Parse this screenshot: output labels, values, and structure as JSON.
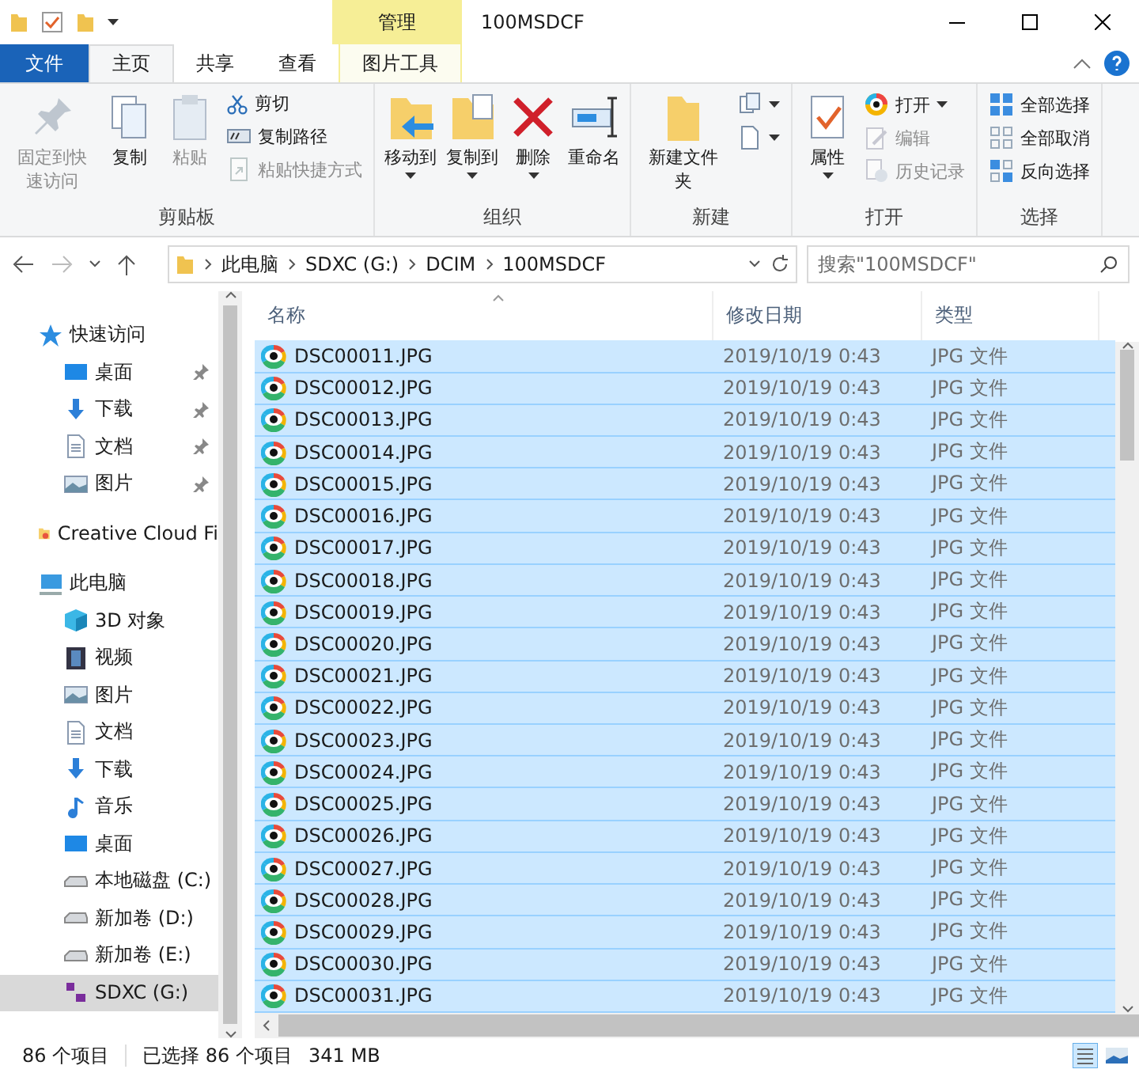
{
  "window": {
    "title": "100MSDCF",
    "context_tab": "管理"
  },
  "ribbon_tabs": [
    {
      "label": "文件",
      "kind": "file",
      "selected": false
    },
    {
      "label": "主页",
      "kind": "normal",
      "selected": true
    },
    {
      "label": "共享",
      "kind": "normal",
      "selected": false
    },
    {
      "label": "查看",
      "kind": "normal",
      "selected": false
    },
    {
      "label": "图片工具",
      "kind": "context",
      "selected": false
    }
  ],
  "ribbon_groups": [
    {
      "label": "剪贴板",
      "buttons": [
        {
          "label": "固定到快速访问",
          "kind": "large",
          "disabled": true
        },
        {
          "label": "复制",
          "kind": "large",
          "disabled": false
        },
        {
          "label": "粘贴",
          "kind": "large",
          "disabled": true
        },
        {
          "label": "剪切",
          "kind": "small",
          "disabled": false
        },
        {
          "label": "复制路径",
          "kind": "small",
          "disabled": false
        },
        {
          "label": "粘贴快捷方式",
          "kind": "small",
          "disabled": true
        }
      ]
    },
    {
      "label": "组织",
      "buttons": [
        {
          "label": "移动到",
          "kind": "large",
          "disabled": false,
          "dropdown": true
        },
        {
          "label": "复制到",
          "kind": "large",
          "disabled": false,
          "dropdown": true
        },
        {
          "label": "删除",
          "kind": "large",
          "disabled": false,
          "dropdown": true
        },
        {
          "label": "重命名",
          "kind": "large",
          "disabled": false
        }
      ]
    },
    {
      "label": "新建",
      "buttons": [
        {
          "label": "新建文件夹",
          "kind": "large",
          "disabled": false
        },
        {
          "kind": "icon",
          "disabled": false,
          "dropdown": true
        },
        {
          "kind": "icon",
          "disabled": false,
          "dropdown": true
        }
      ]
    },
    {
      "label": "打开",
      "buttons": [
        {
          "label": "属性",
          "kind": "large",
          "disabled": false,
          "dropdown": true
        },
        {
          "label": "打开",
          "kind": "small",
          "disabled": false,
          "dropdown": true
        },
        {
          "label": "编辑",
          "kind": "small",
          "disabled": true
        },
        {
          "label": "历史记录",
          "kind": "small",
          "disabled": true
        }
      ]
    },
    {
      "label": "选择",
      "buttons": [
        {
          "label": "全部选择",
          "kind": "small",
          "disabled": false
        },
        {
          "label": "全部取消",
          "kind": "small",
          "disabled": false
        },
        {
          "label": "反向选择",
          "kind": "small",
          "disabled": false
        }
      ]
    }
  ],
  "address": {
    "path": [
      "此电脑",
      "SDXC (G:)",
      "DCIM",
      "100MSDCF"
    ],
    "search_placeholder": "搜索\"100MSDCF\""
  },
  "sidebar": [
    {
      "label": "快速访问",
      "kind": "star",
      "children": [
        {
          "label": "桌面",
          "kind": "desktop",
          "pinned": true
        },
        {
          "label": "下载",
          "kind": "download",
          "pinned": true
        },
        {
          "label": "文档",
          "kind": "document",
          "pinned": true
        },
        {
          "label": "图片",
          "kind": "pictures",
          "pinned": true
        }
      ]
    },
    {
      "label": "Creative Cloud Fi",
      "kind": "cloud"
    },
    {
      "label": "此电脑",
      "kind": "pc",
      "children": [
        {
          "label": "3D 对象",
          "kind": "cube"
        },
        {
          "label": "视频",
          "kind": "video"
        },
        {
          "label": "图片",
          "kind": "pictures"
        },
        {
          "label": "文档",
          "kind": "document"
        },
        {
          "label": "下载",
          "kind": "download"
        },
        {
          "label": "音乐",
          "kind": "music"
        },
        {
          "label": "桌面",
          "kind": "desktop"
        },
        {
          "label": "本地磁盘 (C:)",
          "kind": "drive"
        },
        {
          "label": "新加卷 (D:)",
          "kind": "drive"
        },
        {
          "label": "新加卷 (E:)",
          "kind": "drive"
        },
        {
          "label": "SDXC (G:)",
          "kind": "sd",
          "selected": true
        }
      ]
    }
  ],
  "columns": [
    "名称",
    "修改日期",
    "类型"
  ],
  "rows": [
    {
      "name": "DSC00011.JPG",
      "date": "2019/10/19 0:43",
      "type": "JPG 文件",
      "selected": true
    },
    {
      "name": "DSC00012.JPG",
      "date": "2019/10/19 0:43",
      "type": "JPG 文件",
      "selected": true
    },
    {
      "name": "DSC00013.JPG",
      "date": "2019/10/19 0:43",
      "type": "JPG 文件",
      "selected": true
    },
    {
      "name": "DSC00014.JPG",
      "date": "2019/10/19 0:43",
      "type": "JPG 文件",
      "selected": true
    },
    {
      "name": "DSC00015.JPG",
      "date": "2019/10/19 0:43",
      "type": "JPG 文件",
      "selected": true
    },
    {
      "name": "DSC00016.JPG",
      "date": "2019/10/19 0:43",
      "type": "JPG 文件",
      "selected": true
    },
    {
      "name": "DSC00017.JPG",
      "date": "2019/10/19 0:43",
      "type": "JPG 文件",
      "selected": true
    },
    {
      "name": "DSC00018.JPG",
      "date": "2019/10/19 0:43",
      "type": "JPG 文件",
      "selected": true
    },
    {
      "name": "DSC00019.JPG",
      "date": "2019/10/19 0:43",
      "type": "JPG 文件",
      "selected": true
    },
    {
      "name": "DSC00020.JPG",
      "date": "2019/10/19 0:43",
      "type": "JPG 文件",
      "selected": true
    },
    {
      "name": "DSC00021.JPG",
      "date": "2019/10/19 0:43",
      "type": "JPG 文件",
      "selected": true
    },
    {
      "name": "DSC00022.JPG",
      "date": "2019/10/19 0:43",
      "type": "JPG 文件",
      "selected": true
    },
    {
      "name": "DSC00023.JPG",
      "date": "2019/10/19 0:43",
      "type": "JPG 文件",
      "selected": true
    },
    {
      "name": "DSC00024.JPG",
      "date": "2019/10/19 0:43",
      "type": "JPG 文件",
      "selected": true
    },
    {
      "name": "DSC00025.JPG",
      "date": "2019/10/19 0:43",
      "type": "JPG 文件",
      "selected": true
    },
    {
      "name": "DSC00026.JPG",
      "date": "2019/10/19 0:43",
      "type": "JPG 文件",
      "selected": true
    },
    {
      "name": "DSC00027.JPG",
      "date": "2019/10/19 0:43",
      "type": "JPG 文件",
      "selected": true
    },
    {
      "name": "DSC00028.JPG",
      "date": "2019/10/19 0:43",
      "type": "JPG 文件",
      "selected": true
    },
    {
      "name": "DSC00029.JPG",
      "date": "2019/10/19 0:43",
      "type": "JPG 文件",
      "selected": true
    },
    {
      "name": "DSC00030.JPG",
      "date": "2019/10/19 0:43",
      "type": "JPG 文件",
      "selected": true
    },
    {
      "name": "DSC00031.JPG",
      "date": "2019/10/19 0:43",
      "type": "JPG 文件",
      "selected": true
    }
  ],
  "status": {
    "count": "86 个项目",
    "selection": "已选择 86 个项目",
    "size": "341 MB"
  }
}
